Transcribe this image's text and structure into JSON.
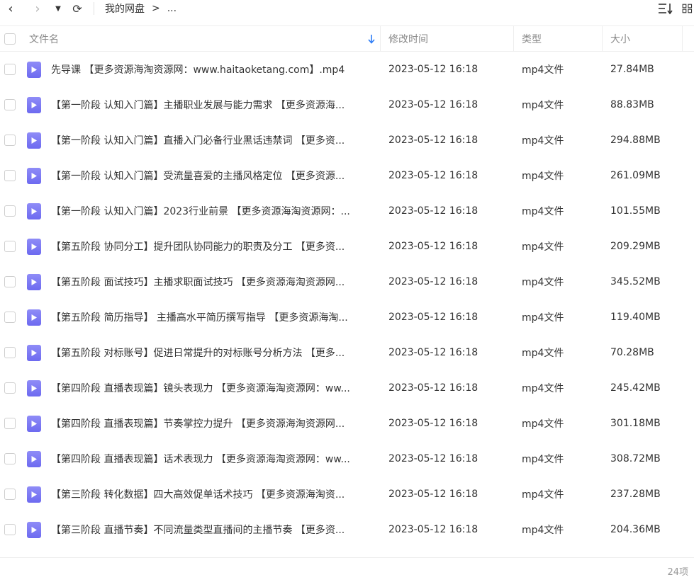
{
  "toolbar": {
    "back_icon": "‹",
    "forward_icon": "›",
    "dropdown_icon": "▼",
    "refresh_icon": "⟳",
    "breadcrumb": [
      "我的网盘",
      ">",
      "..."
    ]
  },
  "columns": {
    "name": "文件名",
    "time": "修改时间",
    "type": "类型",
    "size": "大小"
  },
  "files": [
    {
      "name": "先导课 【更多资源海淘资源网：www.haitaoketang.com】.mp4",
      "time": "2023-05-12 16:18",
      "type": "mp4文件",
      "size": "27.84MB"
    },
    {
      "name": "【第一阶段 认知入门篇】主播职业发展与能力需求 【更多资源海...",
      "time": "2023-05-12 16:18",
      "type": "mp4文件",
      "size": "88.83MB"
    },
    {
      "name": "【第一阶段 认知入门篇】直播入门必备行业黑话违禁词 【更多资...",
      "time": "2023-05-12 16:18",
      "type": "mp4文件",
      "size": "294.88MB"
    },
    {
      "name": "【第一阶段 认知入门篇】受流量喜爱的主播风格定位 【更多资源...",
      "time": "2023-05-12 16:18",
      "type": "mp4文件",
      "size": "261.09MB"
    },
    {
      "name": "【第一阶段 认知入门篇】2023行业前景 【更多资源海淘资源网：...",
      "time": "2023-05-12 16:18",
      "type": "mp4文件",
      "size": "101.55MB"
    },
    {
      "name": "【第五阶段 协同分工】提升团队协同能力的职责及分工 【更多资...",
      "time": "2023-05-12 16:18",
      "type": "mp4文件",
      "size": "209.29MB"
    },
    {
      "name": "【第五阶段 面试技巧】主播求职面试技巧 【更多资源海淘资源网...",
      "time": "2023-05-12 16:18",
      "type": "mp4文件",
      "size": "345.52MB"
    },
    {
      "name": "【第五阶段 简历指导】 主播高水平简历撰写指导 【更多资源海淘...",
      "time": "2023-05-12 16:18",
      "type": "mp4文件",
      "size": "119.40MB"
    },
    {
      "name": "【第五阶段 对标账号】促进日常提升的对标账号分析方法 【更多...",
      "time": "2023-05-12 16:18",
      "type": "mp4文件",
      "size": "70.28MB"
    },
    {
      "name": "【第四阶段 直播表现篇】镜头表现力 【更多资源海淘资源网：ww...",
      "time": "2023-05-12 16:18",
      "type": "mp4文件",
      "size": "245.42MB"
    },
    {
      "name": "【第四阶段 直播表现篇】节奏掌控力提升 【更多资源海淘资源网...",
      "time": "2023-05-12 16:18",
      "type": "mp4文件",
      "size": "301.18MB"
    },
    {
      "name": "【第四阶段 直播表现篇】话术表现力 【更多资源海淘资源网：ww...",
      "time": "2023-05-12 16:18",
      "type": "mp4文件",
      "size": "308.72MB"
    },
    {
      "name": "【第三阶段 转化数据】四大高效促单话术技巧 【更多资源海淘资...",
      "time": "2023-05-12 16:18",
      "type": "mp4文件",
      "size": "237.28MB"
    },
    {
      "name": "【第三阶段 直播节奏】不同流量类型直播间的主播节奏 【更多资...",
      "time": "2023-05-12 16:18",
      "type": "mp4文件",
      "size": "204.36MB"
    }
  ],
  "footer": {
    "count": "24项"
  },
  "colors": {
    "icon_accent": "#7270f2",
    "sort_arrow": "#2b7bf6"
  }
}
